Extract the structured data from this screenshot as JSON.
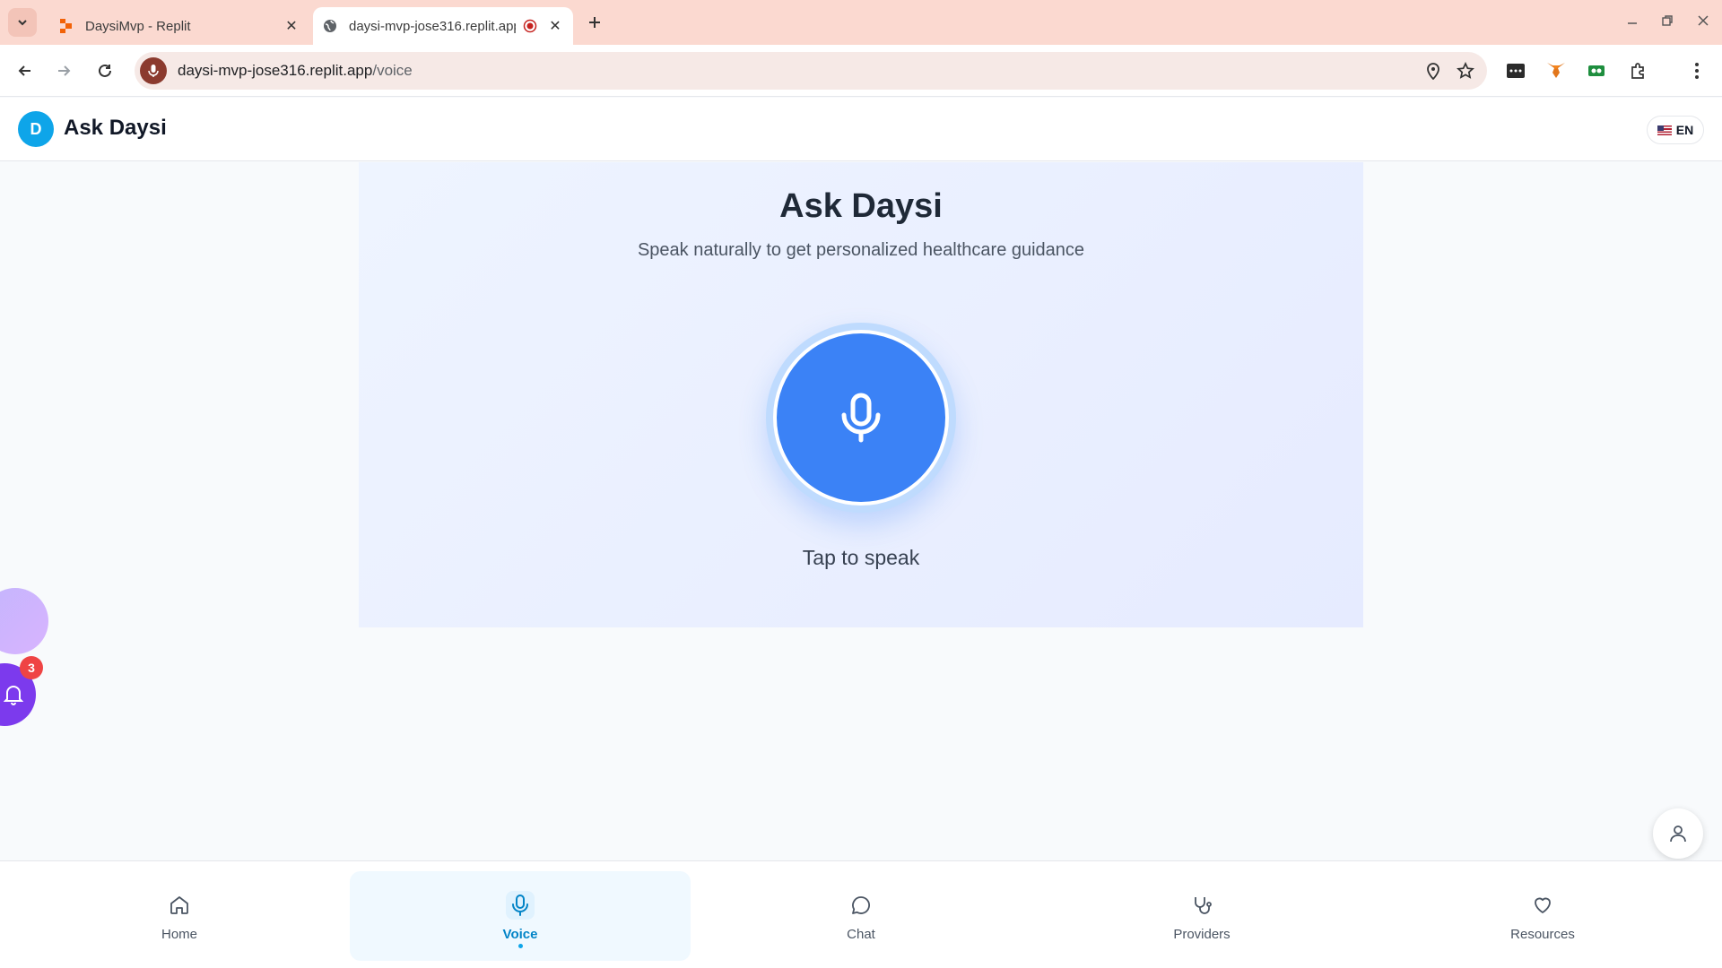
{
  "browser": {
    "tabs": [
      {
        "title": "DaysiMvp - Replit",
        "favicon": "replit-icon",
        "active": false
      },
      {
        "title": "daysi-mvp-jose316.replit.app",
        "favicon": "globe-icon",
        "active": true,
        "recording": true
      }
    ],
    "url_host": "daysi-mvp-jose316.replit.app",
    "url_path": "/voice"
  },
  "header": {
    "logo_letter": "D",
    "title": "Ask Daysi",
    "language": "EN"
  },
  "voice": {
    "title": "Ask Daysi",
    "subtitle": "Speak naturally to get personalized healthcare guidance",
    "action_label": "Tap to speak"
  },
  "notifications": {
    "count": "3"
  },
  "nav": {
    "items": [
      {
        "label": "Home",
        "icon": "home-icon",
        "active": false
      },
      {
        "label": "Voice",
        "icon": "mic-icon",
        "active": true
      },
      {
        "label": "Chat",
        "icon": "chat-icon",
        "active": false
      },
      {
        "label": "Providers",
        "icon": "stethoscope-icon",
        "active": false
      },
      {
        "label": "Resources",
        "icon": "heart-icon",
        "active": false
      }
    ]
  },
  "colors": {
    "primary": "#3b82f6",
    "brand": "#0ea5e9",
    "tabbar": "#fbd9d0",
    "notification": "#7c3aed",
    "badge": "#ef4444"
  }
}
